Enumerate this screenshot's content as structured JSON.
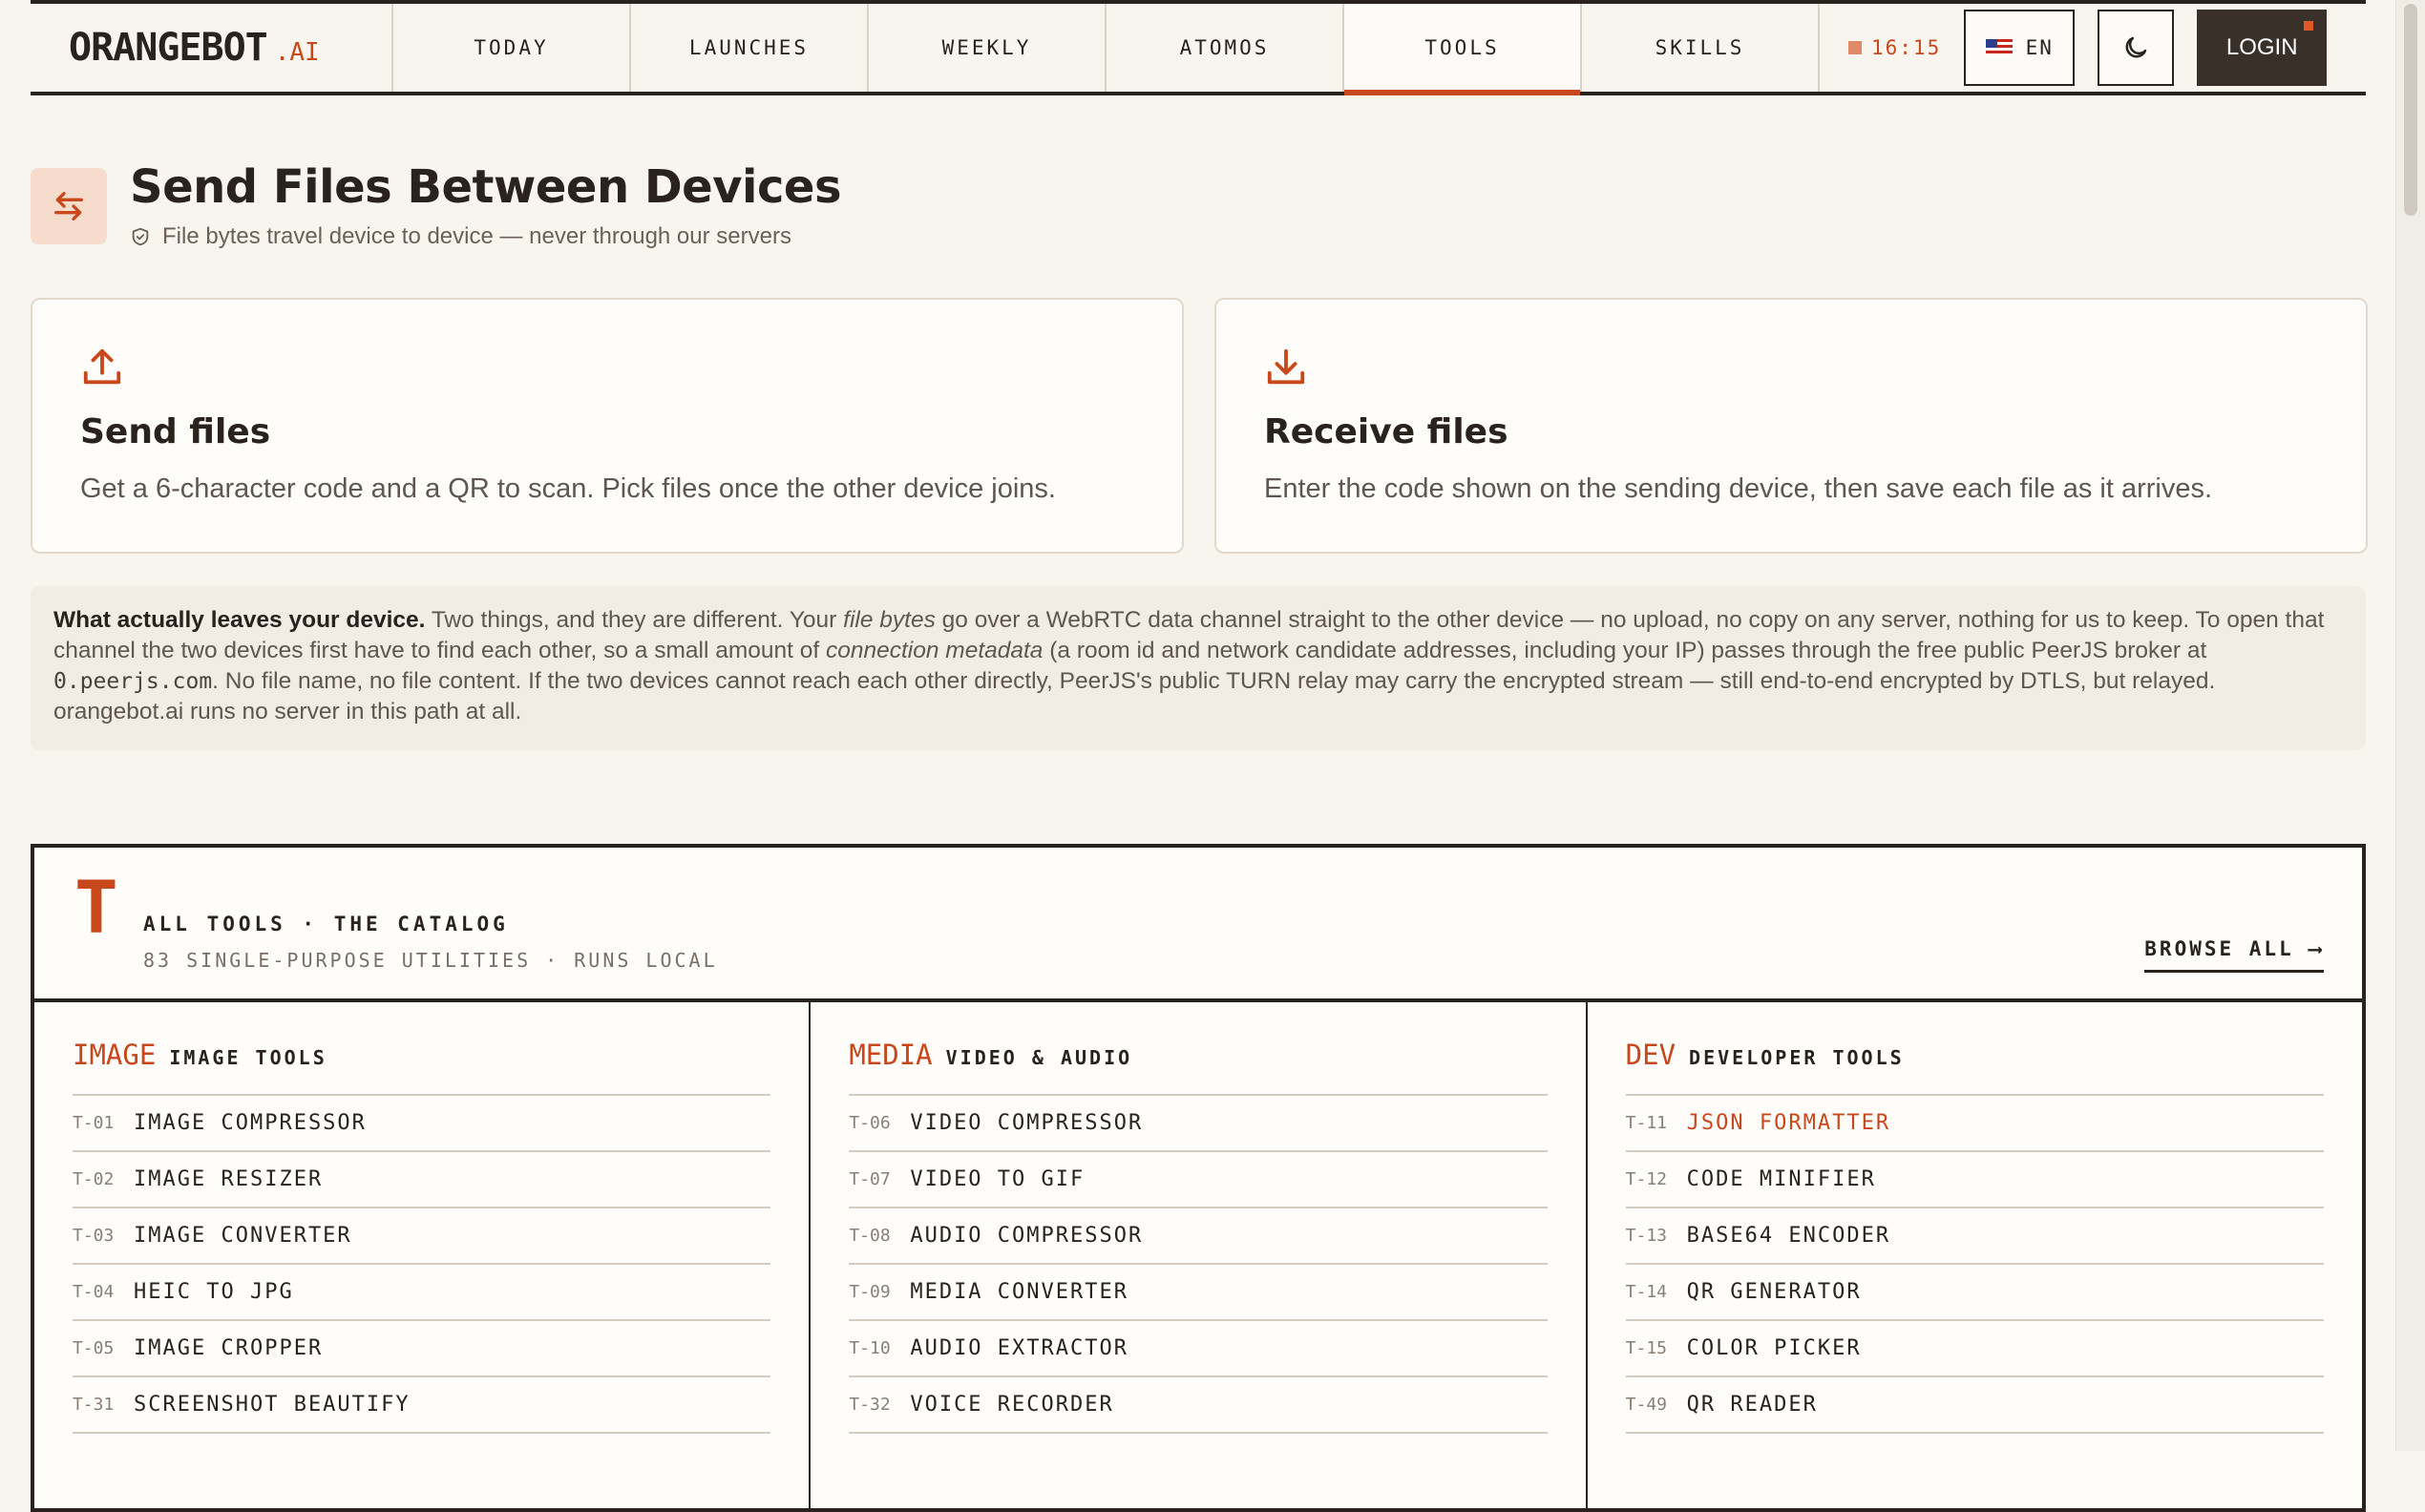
{
  "nav": {
    "logo_main": "ORANGEBOT",
    "logo_suffix": ".AI",
    "tabs": [
      "TODAY",
      "LAUNCHES",
      "WEEKLY",
      "ATOMOS",
      "TOOLS",
      "SKILLS"
    ],
    "active_tab": "TOOLS",
    "clock": "16:15",
    "language": "EN",
    "login_label": "LOGIN"
  },
  "header": {
    "title": "Send Files Between Devices",
    "subtitle": "File bytes travel device to device — never through our servers"
  },
  "cards": [
    {
      "title": "Send files",
      "desc": "Get a 6-character code and a QR to scan. Pick files once the other device joins.",
      "icon": "upload-icon"
    },
    {
      "title": "Receive files",
      "desc": "Enter the code shown on the sending device, then save each file as it arrives.",
      "icon": "download-icon"
    }
  ],
  "note": {
    "lead": "What actually leaves your device.",
    "t1": " Two things, and they are different. Your ",
    "em1": "file bytes",
    "t2": " go over a WebRTC data channel straight to the other device — no upload, no copy on any server, nothing for us to keep. To open that channel the two devices first have to find each other, so a small amount of ",
    "em2": "connection metadata",
    "t3": " (a room id and network candidate addresses, including your IP) passes through the free public PeerJS broker at ",
    "code": "0.peerjs.com",
    "t4": ". No file name, no file content. If the two devices cannot reach each other directly, PeerJS's public TURN relay may carry the encrypted stream — still end-to-end encrypted by DTLS, but relayed. orangebot.ai runs no server in this path at all."
  },
  "catalog": {
    "mark": "T",
    "title": "ALL TOOLS · THE CATALOG",
    "subtitle": "83 SINGLE-PURPOSE UTILITIES · RUNS LOCAL",
    "browse_label": "BROWSE ALL ⟶",
    "columns": [
      {
        "code": "IMAGE",
        "label": "IMAGE TOOLS",
        "items": [
          {
            "num": "T-01",
            "name": "IMAGE COMPRESSOR"
          },
          {
            "num": "T-02",
            "name": "IMAGE RESIZER"
          },
          {
            "num": "T-03",
            "name": "IMAGE CONVERTER"
          },
          {
            "num": "T-04",
            "name": "HEIC TO JPG"
          },
          {
            "num": "T-05",
            "name": "IMAGE CROPPER"
          },
          {
            "num": "T-31",
            "name": "SCREENSHOT BEAUTIFY"
          }
        ]
      },
      {
        "code": "MEDIA",
        "label": "VIDEO & AUDIO",
        "items": [
          {
            "num": "T-06",
            "name": "VIDEO COMPRESSOR"
          },
          {
            "num": "T-07",
            "name": "VIDEO TO GIF"
          },
          {
            "num": "T-08",
            "name": "AUDIO COMPRESSOR"
          },
          {
            "num": "T-09",
            "name": "MEDIA CONVERTER"
          },
          {
            "num": "T-10",
            "name": "AUDIO EXTRACTOR"
          },
          {
            "num": "T-32",
            "name": "VOICE RECORDER"
          }
        ]
      },
      {
        "code": "DEV",
        "label": "DEVELOPER TOOLS",
        "items": [
          {
            "num": "T-11",
            "name": "JSON FORMATTER"
          },
          {
            "num": "T-12",
            "name": "CODE MINIFIER"
          },
          {
            "num": "T-13",
            "name": "BASE64 ENCODER"
          },
          {
            "num": "T-14",
            "name": "QR GENERATOR"
          },
          {
            "num": "T-15",
            "name": "COLOR PICKER"
          },
          {
            "num": "T-49",
            "name": "QR READER"
          }
        ]
      }
    ],
    "highlighted": "JSON FORMATTER"
  },
  "colors": {
    "accent": "#c8481c",
    "ink": "#2a221d",
    "background": "#f8f5ef"
  }
}
